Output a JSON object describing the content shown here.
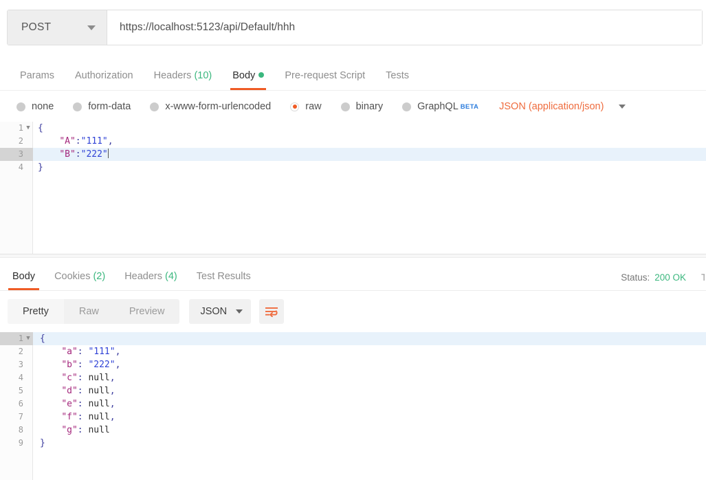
{
  "request": {
    "method": "POST",
    "method_icon": "chevron-down-icon",
    "url": "https://localhost:5123/api/Default/hhh",
    "tabs": [
      {
        "label": "Params",
        "count": "",
        "active": false,
        "dot": false
      },
      {
        "label": "Authorization",
        "count": "",
        "active": false,
        "dot": false
      },
      {
        "label": "Headers",
        "count": "(10)",
        "active": false,
        "dot": false
      },
      {
        "label": "Body",
        "count": "",
        "active": true,
        "dot": true
      },
      {
        "label": "Pre-request Script",
        "count": "",
        "active": false,
        "dot": false
      },
      {
        "label": "Tests",
        "count": "",
        "active": false,
        "dot": false
      }
    ],
    "body_types": [
      {
        "label": "none",
        "checked": false,
        "beta": ""
      },
      {
        "label": "form-data",
        "checked": false,
        "beta": ""
      },
      {
        "label": "x-www-form-urlencoded",
        "checked": false,
        "beta": ""
      },
      {
        "label": "raw",
        "checked": true,
        "beta": ""
      },
      {
        "label": "binary",
        "checked": false,
        "beta": ""
      },
      {
        "label": "GraphQL",
        "checked": false,
        "beta": "BETA"
      }
    ],
    "content_type": "JSON (application/json)",
    "content_type_icon": "chevron-down-icon",
    "body_lines": [
      {
        "num": "1",
        "fold": "▼",
        "highlight": false,
        "tokens": [
          {
            "t": "{",
            "c": "tok-punct"
          }
        ]
      },
      {
        "num": "2",
        "fold": "",
        "highlight": false,
        "tokens": [
          {
            "t": "    ",
            "c": "tok-plain"
          },
          {
            "t": "\"A\"",
            "c": "tok-key"
          },
          {
            "t": ":",
            "c": "tok-punct"
          },
          {
            "t": "\"111\"",
            "c": "tok-str"
          },
          {
            "t": ",",
            "c": "tok-punct"
          }
        ]
      },
      {
        "num": "3",
        "fold": "",
        "highlight": true,
        "caret": true,
        "tokens": [
          {
            "t": "    ",
            "c": "tok-plain"
          },
          {
            "t": "\"B\"",
            "c": "tok-key"
          },
          {
            "t": ":",
            "c": "tok-punct"
          },
          {
            "t": "\"222\"",
            "c": "tok-str"
          }
        ]
      },
      {
        "num": "4",
        "fold": "",
        "highlight": false,
        "tokens": [
          {
            "t": "}",
            "c": "tok-punct"
          }
        ]
      }
    ]
  },
  "response": {
    "tabs": [
      {
        "label": "Body",
        "count": "",
        "active": true
      },
      {
        "label": "Cookies",
        "count": "(2)",
        "active": false
      },
      {
        "label": "Headers",
        "count": "(4)",
        "active": false
      },
      {
        "label": "Test Results",
        "count": "",
        "active": false
      }
    ],
    "status_label": "Status:",
    "status_value": "200 OK",
    "status_cut": "T",
    "view_modes": [
      {
        "label": "Pretty",
        "active": true
      },
      {
        "label": "Raw",
        "active": false
      },
      {
        "label": "Preview",
        "active": false
      }
    ],
    "format": "JSON",
    "format_icon": "chevron-down-icon",
    "wrap_icon": "word-wrap-icon",
    "accent_color": "#ef5b25",
    "status_color": "#3bb77e",
    "body_lines": [
      {
        "num": "1",
        "fold": "▼",
        "highlight": true,
        "tokens": [
          {
            "t": "{",
            "c": "tok-punct"
          }
        ]
      },
      {
        "num": "2",
        "fold": "",
        "highlight": false,
        "tokens": [
          {
            "t": "    ",
            "c": "tok-plain"
          },
          {
            "t": "\"a\"",
            "c": "tok-key"
          },
          {
            "t": ": ",
            "c": "tok-punct"
          },
          {
            "t": "\"111\"",
            "c": "tok-str"
          },
          {
            "t": ",",
            "c": "tok-punct"
          }
        ]
      },
      {
        "num": "3",
        "fold": "",
        "highlight": false,
        "tokens": [
          {
            "t": "    ",
            "c": "tok-plain"
          },
          {
            "t": "\"b\"",
            "c": "tok-key"
          },
          {
            "t": ": ",
            "c": "tok-punct"
          },
          {
            "t": "\"222\"",
            "c": "tok-str"
          },
          {
            "t": ",",
            "c": "tok-punct"
          }
        ]
      },
      {
        "num": "4",
        "fold": "",
        "highlight": false,
        "tokens": [
          {
            "t": "    ",
            "c": "tok-plain"
          },
          {
            "t": "\"c\"",
            "c": "tok-key"
          },
          {
            "t": ": ",
            "c": "tok-punct"
          },
          {
            "t": "null",
            "c": "tok-null"
          },
          {
            "t": ",",
            "c": "tok-punct"
          }
        ]
      },
      {
        "num": "5",
        "fold": "",
        "highlight": false,
        "tokens": [
          {
            "t": "    ",
            "c": "tok-plain"
          },
          {
            "t": "\"d\"",
            "c": "tok-key"
          },
          {
            "t": ": ",
            "c": "tok-punct"
          },
          {
            "t": "null",
            "c": "tok-null"
          },
          {
            "t": ",",
            "c": "tok-punct"
          }
        ]
      },
      {
        "num": "6",
        "fold": "",
        "highlight": false,
        "tokens": [
          {
            "t": "    ",
            "c": "tok-plain"
          },
          {
            "t": "\"e\"",
            "c": "tok-key"
          },
          {
            "t": ": ",
            "c": "tok-punct"
          },
          {
            "t": "null",
            "c": "tok-null"
          },
          {
            "t": ",",
            "c": "tok-punct"
          }
        ]
      },
      {
        "num": "7",
        "fold": "",
        "highlight": false,
        "tokens": [
          {
            "t": "    ",
            "c": "tok-plain"
          },
          {
            "t": "\"f\"",
            "c": "tok-key"
          },
          {
            "t": ": ",
            "c": "tok-punct"
          },
          {
            "t": "null",
            "c": "tok-null"
          },
          {
            "t": ",",
            "c": "tok-punct"
          }
        ]
      },
      {
        "num": "8",
        "fold": "",
        "highlight": false,
        "tokens": [
          {
            "t": "    ",
            "c": "tok-plain"
          },
          {
            "t": "\"g\"",
            "c": "tok-key"
          },
          {
            "t": ": ",
            "c": "tok-punct"
          },
          {
            "t": "null",
            "c": "tok-null"
          }
        ]
      },
      {
        "num": "9",
        "fold": "",
        "highlight": false,
        "tokens": [
          {
            "t": "}",
            "c": "tok-punct"
          }
        ]
      }
    ]
  }
}
